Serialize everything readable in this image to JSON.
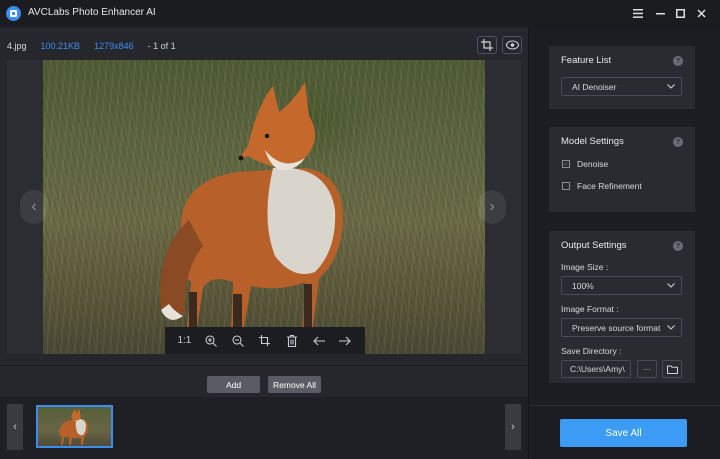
{
  "app": {
    "title": "AVCLabs Photo Enhancer AI"
  },
  "window_controls": {
    "menu_icon": "menu-icon",
    "minimize_icon": "minimize-icon",
    "maximize_icon": "maximize-icon",
    "close_icon": "close-icon"
  },
  "image_info": {
    "filename": "4.jpg",
    "filesize": "100.21KB",
    "resolution": "1279x846",
    "position": "- 1 of 1"
  },
  "viewer_toolbar": {
    "actual_size_label": "1:1"
  },
  "actions": {
    "add_label": "Add",
    "remove_all_label": "Remove All"
  },
  "feature_list": {
    "title": "Feature List",
    "selected": "AI Denoiser"
  },
  "model_settings": {
    "title": "Model Settings",
    "options": [
      {
        "label": "Denoise",
        "checked": true
      },
      {
        "label": "Face Refinement",
        "checked": false
      }
    ]
  },
  "output_settings": {
    "title": "Output Settings",
    "image_size_label": "Image Size :",
    "image_size_value": "100%",
    "image_format_label": "Image Format :",
    "image_format_value": "Preserve source format",
    "save_directory_label": "Save Directory :",
    "save_directory_value": "C:\\Users\\Amy\\",
    "more_label": "···"
  },
  "save_all_label": "Save All",
  "colors": {
    "accent": "#3b9bf5",
    "link_blue": "#3b8df0",
    "panel": "#2a2b31",
    "background": "#1f2025"
  }
}
